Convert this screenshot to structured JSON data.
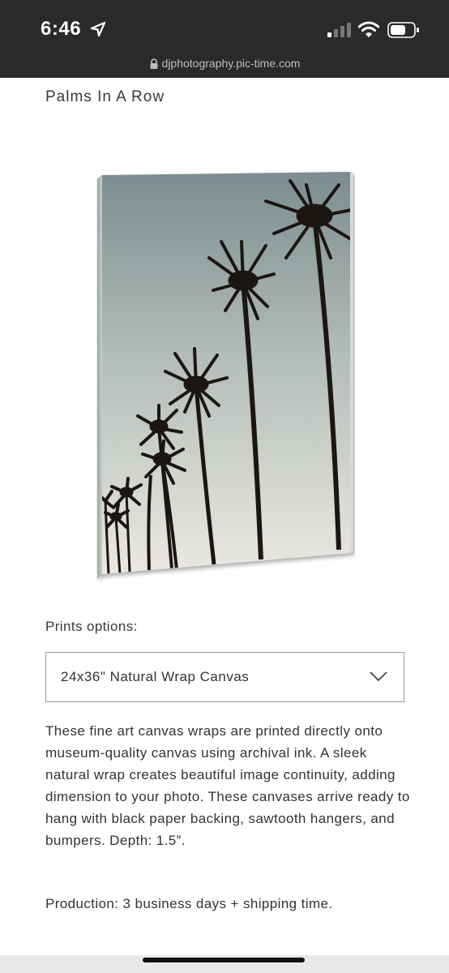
{
  "status_bar": {
    "time": "6:46",
    "icons": [
      "location-arrow-icon",
      "cellular-signal-icon",
      "wifi-icon",
      "battery-icon"
    ]
  },
  "browser": {
    "url": "djphotography.pic-time.com",
    "lock_icon": "lock-icon"
  },
  "product": {
    "title": "Palms In A Row",
    "image_alt": "canvas print of palm trees silhouetted against a sunset sky"
  },
  "options": {
    "label": "Prints options:",
    "selected": "24x36\" Natural Wrap Canvas",
    "chevron_icon": "chevron-down-icon"
  },
  "description": "These fine art canvas wraps are printed directly onto museum-quality canvas using archival ink. A sleek natural wrap creates beautiful image continuity, adding dimension to your photo. These canvases arrive ready to hang with black paper backing, sawtooth hangers, and bumpers. Depth: 1.5”.",
  "production": "Production: 3 business days + shipping time.",
  "colors": {
    "chrome_bg": "#2a2a2a",
    "sky_top": "#7d8e90",
    "sky_bottom": "#e6e4df",
    "palm": "#1c1612"
  }
}
